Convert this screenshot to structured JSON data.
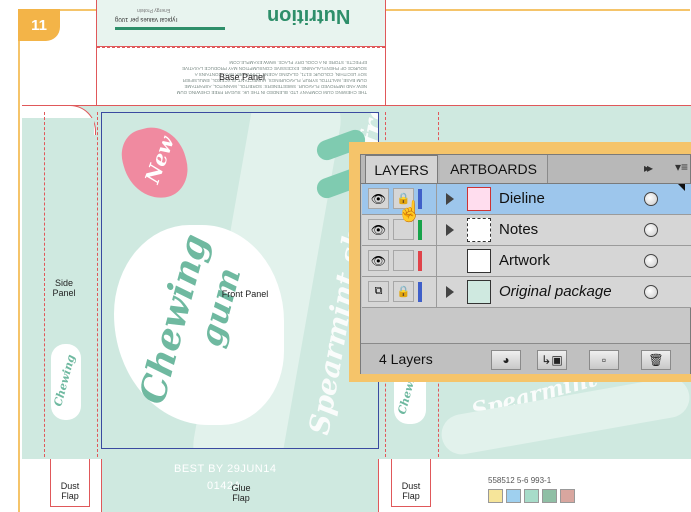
{
  "step": {
    "number": "11"
  },
  "artwork": {
    "nutrition_title": "Nutrition",
    "nutrition_sub": "Typical Values per 100g",
    "nutrition_sub2": "Energy  Protein",
    "base_panel": "Base Panel",
    "side_panel": "Side\nPanel",
    "front_panel": "Front Panel",
    "new_badge": "New",
    "brand_line1": "Chewing",
    "brand_line2": "gum",
    "slogan": "Spearmint shugar free",
    "slogan_short": "Spearmint",
    "best_by": "BEST BY 29JUN14",
    "lot_code": "0142A",
    "glue_flap": "Glue\nFlap",
    "dust_flap_left": "Dust\nFlap",
    "dust_flap_right": "Dust\nFlap",
    "swatch_codes": "558512  5-6   993-1",
    "swatch_colors": [
      "#f6e59a",
      "#9fd0ef",
      "#a7dcc9",
      "#8fbfa5",
      "#d8a69f"
    ],
    "base_copy": [
      "THE CHEWING GUM COMPANY LTD. BLENDED IN THE UK. SUGAR FREE CHEWING GUM",
      "NEW AND IMPROVED FLAVOUR. SWEETENERS: SORBITOL, MANNITOL, ASPARTAME",
      "GUM BASE, MALTITOL SYRUP, FLAVOURINGS, HUMECTANT: GLYCEROL, EMULSIFIER",
      "SOY LECITHIN, COLOUR: E171, GLAZING AGENT: CARNAUBA WAX. CONTAINS A",
      "SOURCE OF PHENYLALANINE. EXCESSIVE CONSUMPTION MAY PRODUCE LAXATIVE",
      "EFFECTS. STORE IN A COOL DRY PLACE. WWW.EXAMPLE.COM"
    ]
  },
  "layers_panel": {
    "tabs": [
      "LAYERS",
      "ARTBOARDS"
    ],
    "fast_forward": "▸▸",
    "menu": "▾≡",
    "layers": [
      {
        "name": "Dieline",
        "color": "#3f5fc9",
        "selected": true,
        "locked": true,
        "italic": false,
        "expandable": true
      },
      {
        "name": "Notes",
        "color": "#17a34a",
        "selected": false,
        "locked": false,
        "italic": false,
        "expandable": true
      },
      {
        "name": "Artwork",
        "color": "#e0434a",
        "selected": false,
        "locked": false,
        "italic": false,
        "expandable": false
      },
      {
        "name": "Original package",
        "color": "#3f5fc9",
        "selected": false,
        "locked": true,
        "italic": true,
        "expandable": true
      }
    ],
    "count": "4 Layers",
    "footer_icons": [
      "locate-object-icon",
      "make-clipping-mask-icon",
      "create-sublayer-icon",
      "new-layer-icon",
      "delete-icon"
    ]
  },
  "colors": {
    "accent": "#f5c46a",
    "mint": "#cfe9e0",
    "dieline": "#e0585a",
    "selection": "#9dc6ec"
  }
}
